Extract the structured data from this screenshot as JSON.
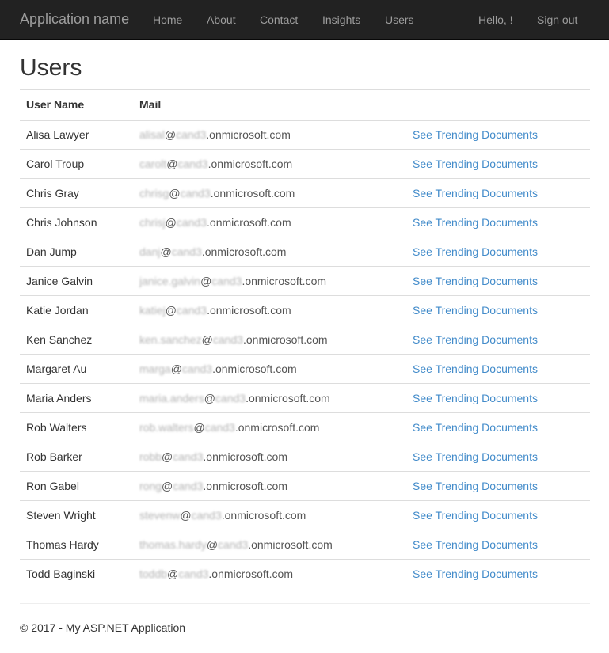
{
  "navbar": {
    "brand": "Application name",
    "items": [
      "Home",
      "About",
      "Contact",
      "Insights",
      "Users"
    ],
    "greeting": "Hello, !",
    "signout": "Sign out"
  },
  "page": {
    "title": "Users"
  },
  "table": {
    "headers": [
      "User Name",
      "Mail",
      ""
    ],
    "link_label": "See Trending Documents",
    "rows": [
      {
        "name": "Alisa Lawyer",
        "mail_user": "alisal",
        "mail_at": "@",
        "mail_tenant": "cand3",
        "mail_domain": ".onmicrosoft.com"
      },
      {
        "name": "Carol Troup",
        "mail_user": "carolt",
        "mail_at": "@",
        "mail_tenant": "cand3",
        "mail_domain": ".onmicrosoft.com"
      },
      {
        "name": "Chris Gray",
        "mail_user": "chrisg",
        "mail_at": "@",
        "mail_tenant": "cand3",
        "mail_domain": ".onmicrosoft.com"
      },
      {
        "name": "Chris Johnson",
        "mail_user": "chrisj",
        "mail_at": "@",
        "mail_tenant": "cand3",
        "mail_domain": ".onmicrosoft.com"
      },
      {
        "name": "Dan Jump",
        "mail_user": "danj",
        "mail_at": "@",
        "mail_tenant": "cand3",
        "mail_domain": ".onmicrosoft.com"
      },
      {
        "name": "Janice Galvin",
        "mail_user": "janice.galvin",
        "mail_at": "@",
        "mail_tenant": "cand3",
        "mail_domain": ".onmicrosoft.com"
      },
      {
        "name": "Katie Jordan",
        "mail_user": "katiej",
        "mail_at": "@",
        "mail_tenant": "cand3",
        "mail_domain": ".onmicrosoft.com"
      },
      {
        "name": "Ken Sanchez",
        "mail_user": "ken.sanchez",
        "mail_at": "@",
        "mail_tenant": "cand3",
        "mail_domain": ".onmicrosoft.com"
      },
      {
        "name": "Margaret Au",
        "mail_user": "marga",
        "mail_at": "@",
        "mail_tenant": "cand3",
        "mail_domain": ".onmicrosoft.com"
      },
      {
        "name": "Maria Anders",
        "mail_user": "maria.anders",
        "mail_at": "@",
        "mail_tenant": "cand3",
        "mail_domain": ".onmicrosoft.com"
      },
      {
        "name": "Rob Walters",
        "mail_user": "rob.walters",
        "mail_at": "@",
        "mail_tenant": "cand3",
        "mail_domain": ".onmicrosoft.com"
      },
      {
        "name": "Rob Barker",
        "mail_user": "robb",
        "mail_at": "@",
        "mail_tenant": "cand3",
        "mail_domain": ".onmicrosoft.com"
      },
      {
        "name": "Ron Gabel",
        "mail_user": "rong",
        "mail_at": "@",
        "mail_tenant": "cand3",
        "mail_domain": ".onmicrosoft.com"
      },
      {
        "name": "Steven Wright",
        "mail_user": "stevenw",
        "mail_at": "@",
        "mail_tenant": "cand3",
        "mail_domain": ".onmicrosoft.com"
      },
      {
        "name": "Thomas Hardy",
        "mail_user": "thomas.hardy",
        "mail_at": "@",
        "mail_tenant": "cand3",
        "mail_domain": ".onmicrosoft.com"
      },
      {
        "name": "Todd Baginski",
        "mail_user": "toddb",
        "mail_at": "@",
        "mail_tenant": "cand3",
        "mail_domain": ".onmicrosoft.com"
      }
    ]
  },
  "footer": {
    "text": "© 2017 - My ASP.NET Application"
  },
  "colors": {
    "navbar_bg": "#222222",
    "nav_text": "#9d9d9d",
    "link": "#428bca",
    "rule": "#dddddd"
  }
}
